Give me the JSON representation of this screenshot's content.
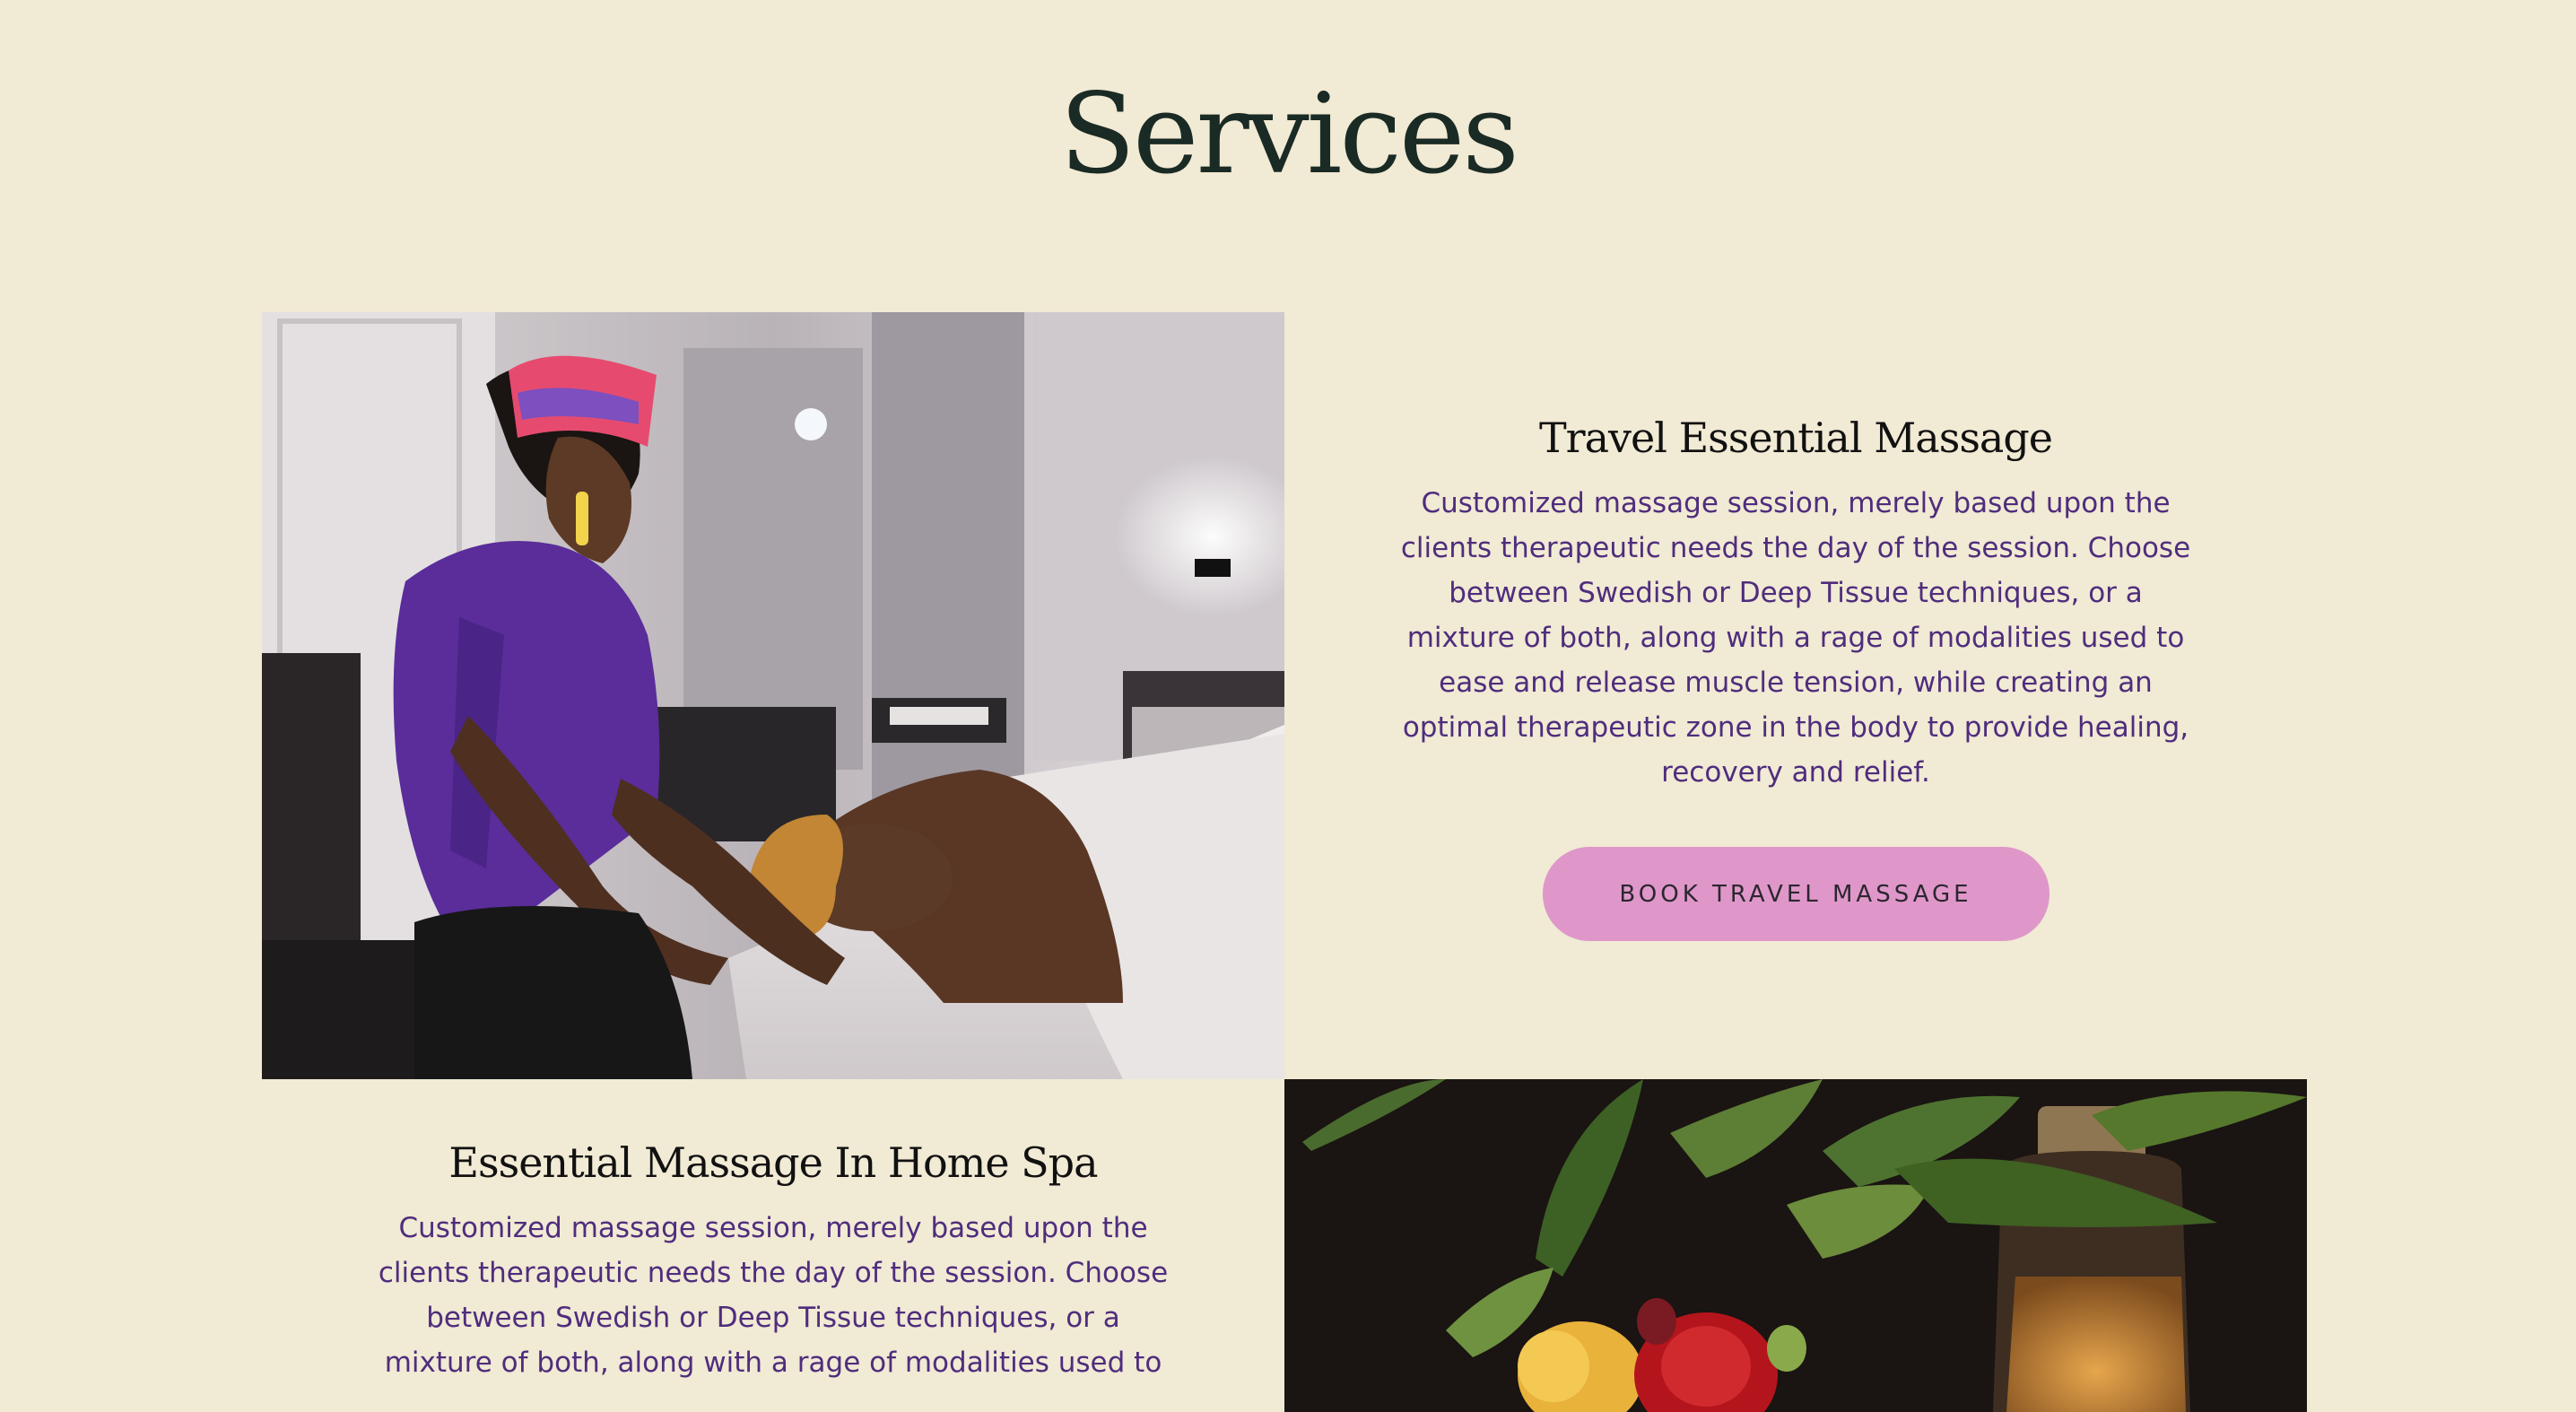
{
  "page": {
    "title": "Services"
  },
  "services": [
    {
      "title": "Travel Essential Massage",
      "description": "Customized massage session, merely based upon the\nclients therapeutic needs the day of the session.  Choose\nbetween Swedish or Deep Tissue techniques, or a\nmixture of both, along with a rage of modalities used to\nease and release muscle tension, while creating an\noptimal therapeutic zone in the body to provide healing,\nrecovery and relief.",
      "button_label": "BOOK TRAVEL MASSAGE",
      "button_color": "#df97c9"
    },
    {
      "title": "Essential Massage In Home Spa",
      "description": "Customized massage session, merely based upon the\nclients therapeutic needs the day of the session.  Choose\nbetween Swedish or Deep Tissue techniques, or a\nmixture of both, along with a rage of modalities used to"
    }
  ],
  "images": [
    {
      "icon": "massage-therapist-photo"
    },
    {
      "icon": "flowers-and-oil-photo"
    }
  ],
  "colors": {
    "background": "#f1ead4",
    "body_text": "#4f2d7d",
    "heading_text": "#1a2a24",
    "button": "#df97c9"
  }
}
